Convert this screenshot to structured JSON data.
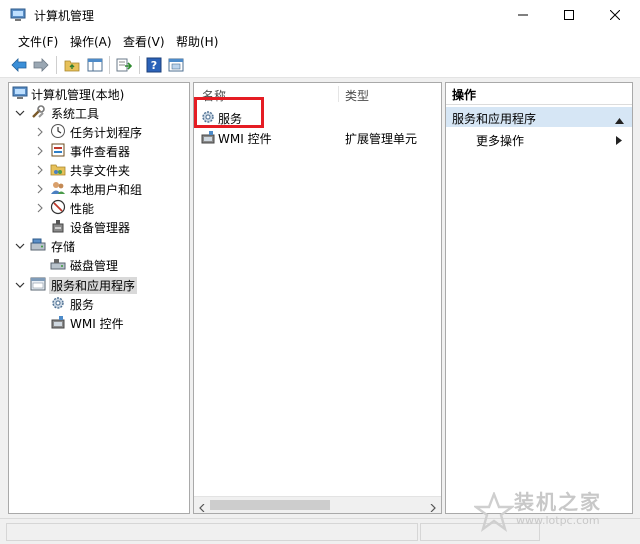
{
  "window": {
    "title": "计算机管理"
  },
  "menu": {
    "items": [
      "文件(F)",
      "操作(A)",
      "查看(V)",
      "帮助(H)"
    ]
  },
  "toolbar": {
    "icons": [
      "back-arrow-icon",
      "forward-arrow-icon",
      "up-folder-icon",
      "show-hide-tree-icon",
      "export-list-icon",
      "help-icon",
      "properties-icon"
    ]
  },
  "tree": {
    "root": "计算机管理(本地)",
    "system_tools": "系统工具",
    "task_scheduler": "任务计划程序",
    "event_viewer": "事件查看器",
    "shared_folders": "共享文件夹",
    "local_users_groups": "本地用户和组",
    "performance": "性能",
    "device_manager": "设备管理器",
    "storage": "存储",
    "disk_management": "磁盘管理",
    "services_apps": "服务和应用程序",
    "services": "服务",
    "wmi_control": "WMI 控件"
  },
  "list": {
    "col_name": "名称",
    "col_type": "类型",
    "rows": [
      {
        "name": "服务",
        "type": ""
      },
      {
        "name": "WMI 控件",
        "type": "扩展管理单元"
      }
    ]
  },
  "actions": {
    "header": "操作",
    "section": "服务和应用程序",
    "more": "更多操作"
  },
  "watermark": {
    "title": "装机之家",
    "url": "www.lotpc.com"
  },
  "colors": {
    "highlight_box": "#e51c23",
    "action_section_bg": "#d6e6f5",
    "selected_bg": "#d9d9d9"
  }
}
